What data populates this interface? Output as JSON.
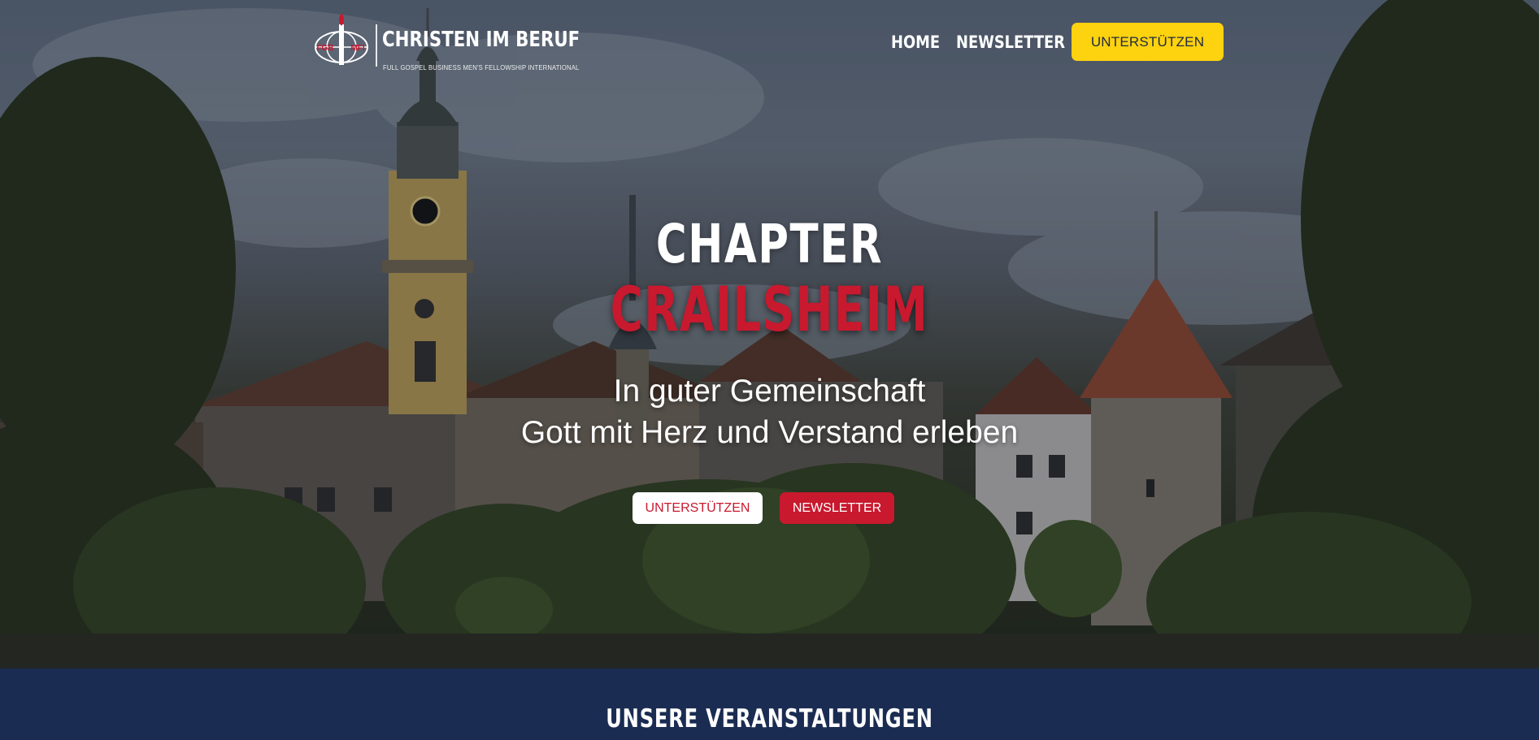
{
  "header": {
    "logo": {
      "title": "CHRISTEN IM BERUF",
      "subtitle": "FULL GOSPEL BUSINESS MEN'S FELLOWSHIP INTERNATIONAL",
      "emblem_left": "FGB",
      "emblem_right": "MFI"
    },
    "nav": [
      {
        "label": "HOME"
      },
      {
        "label": "NEWSLETTER"
      }
    ],
    "cta_label": "UNTERSTÜTZEN"
  },
  "hero": {
    "title_line1": "CHAPTER",
    "title_line2": "CRAILSHEIM",
    "subtitle_line1": "In guter Gemeinschaft",
    "subtitle_line2": "Gott mit Herz und Verstand erleben",
    "buttons": {
      "support": "UNTERSTÜTZEN",
      "newsletter": "NEWSLETTER"
    }
  },
  "events": {
    "heading": "UNSERE VERANSTALTUNGEN"
  },
  "colors": {
    "accent_yellow": "#fdd20f",
    "accent_red": "#c8192e",
    "navy": "#1b2c52",
    "white": "#ffffff"
  },
  "icons": [
    "fgbmfi-logo-icon",
    "torch-icon",
    "globe-icon"
  ]
}
